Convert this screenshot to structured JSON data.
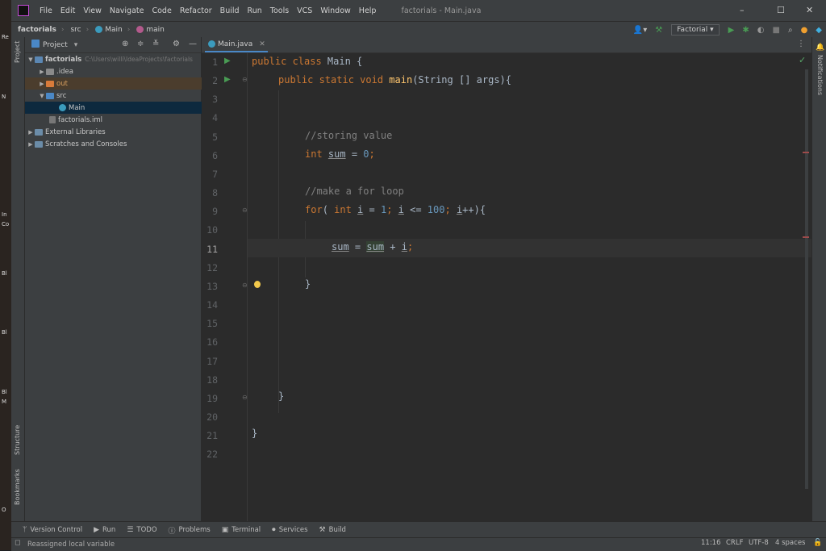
{
  "desktop": {
    "labels": [
      "Re",
      "N",
      "In",
      "Co",
      "Bl",
      "Bl",
      "Bl",
      "M",
      "O"
    ]
  },
  "menubar": {
    "items": [
      "File",
      "Edit",
      "View",
      "Navigate",
      "Code",
      "Refactor",
      "Build",
      "Run",
      "Tools",
      "VCS",
      "Window",
      "Help"
    ],
    "title": "factorials - Main.java"
  },
  "navbar": {
    "crumbs": [
      "factorials",
      "src",
      "Main",
      "main"
    ],
    "run_config": "Factorial"
  },
  "left_strip": {
    "project": "Project",
    "structure": "Structure",
    "bookmarks": "Bookmarks"
  },
  "right_strip": {
    "notifications": "Notifications"
  },
  "project_panel": {
    "title": "Project",
    "tree": [
      {
        "label": "factorials",
        "path": "C:\\Users\\willi\\IdeaProjects\\factorials"
      },
      {
        "label": ".idea"
      },
      {
        "label": "out"
      },
      {
        "label": "src"
      },
      {
        "label": "Main"
      },
      {
        "label": "factorials.iml"
      },
      {
        "label": "External Libraries"
      },
      {
        "label": "Scratches and Consoles"
      }
    ]
  },
  "editor": {
    "tab": "Main.java",
    "line_numbers": [
      "1",
      "2",
      "3",
      "4",
      "5",
      "6",
      "7",
      "8",
      "9",
      "10",
      "11",
      "12",
      "13",
      "14",
      "15",
      "16",
      "17",
      "18",
      "19",
      "20",
      "21",
      "22"
    ],
    "current_line": "11",
    "code": {
      "l1": [
        "public class ",
        "Main",
        " {"
      ],
      "l2": [
        "public static void ",
        "main",
        "(String [] args){"
      ],
      "l5": "//storing value",
      "l6": [
        "int ",
        "sum",
        " = ",
        "0",
        ";"
      ],
      "l8": "//make a for loop",
      "l9": [
        "for",
        "( ",
        "int ",
        "i",
        " = ",
        "1",
        "; ",
        "i",
        " <= ",
        "100",
        "; ",
        "i",
        "++){"
      ],
      "l11": [
        "sum",
        " = ",
        "sum",
        " + ",
        "i",
        ";"
      ],
      "l13": "}",
      "l19": "}",
      "l21": "}"
    }
  },
  "tool_windows": [
    {
      "label": "Version Control",
      "icon": "branch-icon"
    },
    {
      "label": "Run",
      "icon": "play-icon"
    },
    {
      "label": "TODO",
      "icon": "list-icon"
    },
    {
      "label": "Problems",
      "icon": "info-icon"
    },
    {
      "label": "Terminal",
      "icon": "terminal-icon"
    },
    {
      "label": "Services",
      "icon": "services-icon"
    },
    {
      "label": "Build",
      "icon": "hammer-icon"
    }
  ],
  "status": {
    "message": "Reassigned local variable",
    "position": "11:16",
    "line_sep": "CRLF",
    "encoding": "UTF-8",
    "indent": "4 spaces"
  },
  "colors": {
    "keyword": "#cc7832",
    "function": "#ffc66d",
    "comment": "#808080",
    "number": "#6897bb",
    "run_green": "#499c54"
  }
}
